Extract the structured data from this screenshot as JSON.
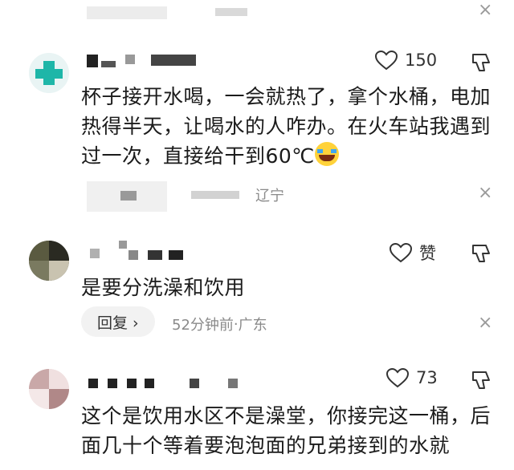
{
  "comments": [
    {
      "likes": "150",
      "text": "杯子接开水喝，一会就热了，拿个水桶，电加热得半天，让喝水的人咋办。在火车站我遇到过一次，直接给干到60℃",
      "emoji": "laughing-crying-emoji",
      "meta_location": "辽宁"
    },
    {
      "likes": "赞",
      "text": "是要分洗澡和饮用",
      "reply_label": "回复 ›",
      "meta_time": "52分钟前",
      "meta_sep": " · ",
      "meta_location": "广东"
    },
    {
      "likes": "73",
      "text": "这个是饮用水区不是澡堂，你接完这一桶，后面几十个等着要泡泡面的兄弟接到的水就"
    }
  ],
  "close_glyph": "×",
  "colors": {
    "text": "#1b1b1b",
    "meta": "#8a8a8a",
    "pill_bg": "#f2f2f2",
    "avatar_teal": "#1eb6a8"
  }
}
